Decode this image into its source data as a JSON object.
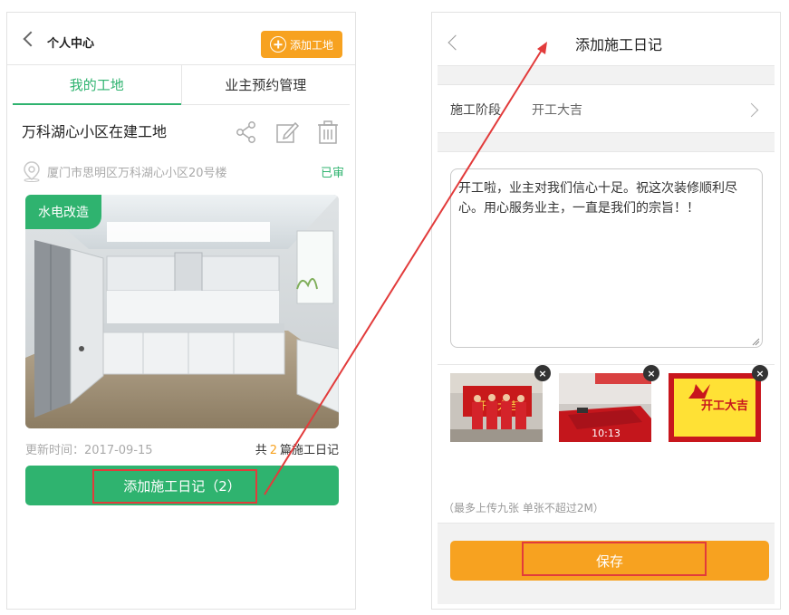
{
  "left_screen": {
    "header": {
      "title": "个人中心",
      "add_site_label": "添加工地"
    },
    "tabs": [
      {
        "label": "我的工地",
        "active": true
      },
      {
        "label": "业主预约管理",
        "active": false
      }
    ],
    "site": {
      "name": "万科湖心小区在建工地",
      "address": "厦门市思明区万科湖心小区20号楼",
      "status": "已审",
      "photo_badge": "水电改造",
      "updated": "更新时间：2017-09-15",
      "count_prefix": "共",
      "count": "2",
      "count_suffix": "篇施工日记"
    },
    "add_log_button": "添加施工日记（2）"
  },
  "right_screen": {
    "header": {
      "title": "添加施工日记"
    },
    "stage": {
      "label": "施工阶段",
      "value": "开工大吉"
    },
    "log_text": "开工啦，业主对我们信心十足。祝这次装修顺利尽心。用心服务业主，一直是我们的宗旨！！",
    "thumbnails": [
      {
        "caption": "开工大吉"
      },
      {
        "caption": "10:13"
      },
      {
        "caption": "开工大吉"
      }
    ],
    "upload_note": "（最多上传九张 单张不超过2M）",
    "save_button": "保存"
  },
  "colors": {
    "green": "#2fb36f",
    "orange": "#f7a220",
    "highlight_red": "#e23b3b"
  }
}
